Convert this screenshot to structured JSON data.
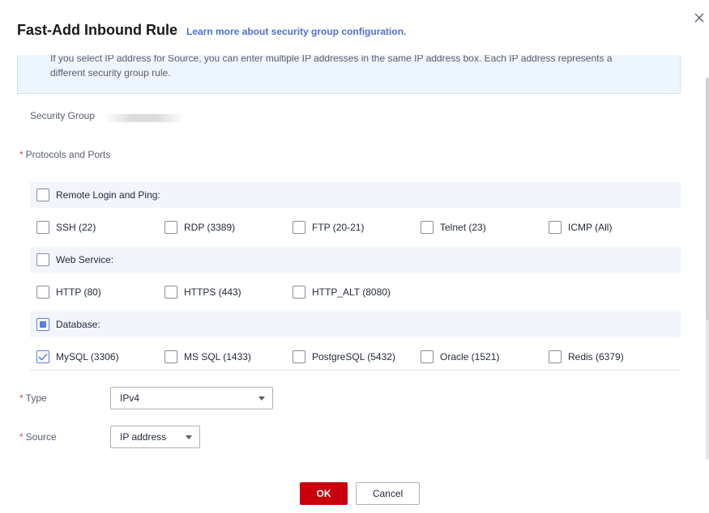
{
  "dialog": {
    "title": "Fast-Add Inbound Rule",
    "learn_more": "Learn more about security group configuration."
  },
  "notice": {
    "line1": "If you select IP address for Source, you can enter multiple IP addresses in the same IP address box. Each IP address represents a",
    "line2": "different security group rule."
  },
  "fields": {
    "security_group_label": "Security Group",
    "protocols_label": "Protocols and Ports",
    "type_label": "Type",
    "source_label": "Source",
    "required_mark": "*"
  },
  "groups": {
    "remote": {
      "label": "Remote Login and Ping:",
      "items": [
        "SSH (22)",
        "RDP (3389)",
        "FTP (20-21)",
        "Telnet (23)",
        "ICMP (All)"
      ]
    },
    "web": {
      "label": "Web Service:",
      "items": [
        "HTTP (80)",
        "HTTPS (443)",
        "HTTP_ALT (8080)"
      ]
    },
    "database": {
      "label": "Database:",
      "state": "partial",
      "items": [
        "MySQL (3306)",
        "MS SQL (1433)",
        "PostgreSQL (5432)",
        "Oracle (1521)",
        "Redis (6379)"
      ],
      "checked": [
        "MySQL (3306)"
      ]
    }
  },
  "type_select": {
    "value": "IPv4"
  },
  "source_select": {
    "value": "IP address"
  },
  "buttons": {
    "ok": "OK",
    "cancel": "Cancel"
  },
  "colors": {
    "primary": "#c7000b",
    "link": "#526ecc",
    "check": "#5e7ce0",
    "required": "#e54545"
  }
}
